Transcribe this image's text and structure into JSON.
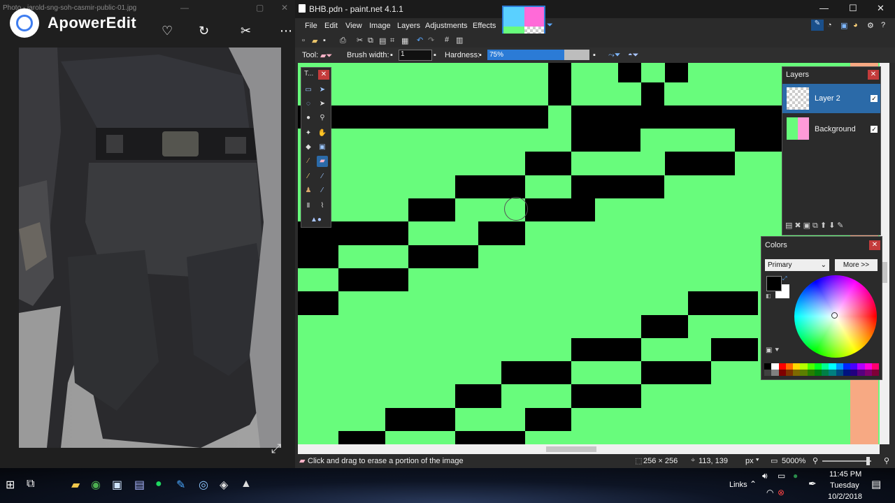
{
  "viewer": {
    "filename": "Photo - jarold-sng-soh-casmir-public-01.jpg",
    "app_name": "ApowerEdit"
  },
  "paintnet": {
    "title": "BHB.pdn - paint.net 4.1.1",
    "menu": [
      "File",
      "Edit",
      "View",
      "Image",
      "Layers",
      "Adjustments",
      "Effects"
    ],
    "tool_label": "Tool:",
    "brush_width_label": "Brush width:",
    "brush_width_value": "1",
    "hardness_label": "Hardness:",
    "hardness_value": "75%",
    "tools_title": "T...",
    "layers_title": "Layers",
    "layers": [
      {
        "name": "Layer 2",
        "checked": true,
        "selected": true
      },
      {
        "name": "Background",
        "checked": true,
        "selected": false
      }
    ],
    "colors_title": "Colors",
    "colors_mode": "Primary",
    "colors_more": "More >>",
    "status_hint": "Click and drag to erase a portion of the image",
    "image_size": "256 × 256",
    "cursor_pos": "113, 139",
    "units": "px",
    "zoom": "5000%",
    "accent_color": "#2b7bd6",
    "canvas_green": "#68fc7c"
  },
  "taskbar": {
    "links_label": "Links",
    "time": "11:45 PM",
    "day": "Tuesday",
    "date": "10/2/2018"
  }
}
